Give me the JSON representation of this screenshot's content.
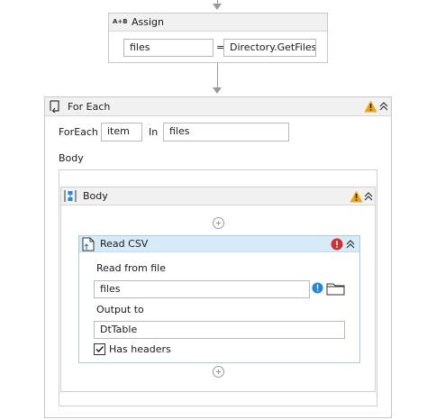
{
  "assign": {
    "icon_text": "A+B",
    "title": "Assign",
    "left_value": "files",
    "operator": "=",
    "right_value": "Directory.GetFiles("
  },
  "foreach": {
    "title": "For Each",
    "foreach_label": "ForEach",
    "item_value": "item",
    "in_label": "In",
    "collection_value": "files",
    "body_label": "Body"
  },
  "body_sequence": {
    "title": "Body"
  },
  "read_csv": {
    "title": "Read CSV",
    "read_from_label": "Read from file",
    "read_from_value": "files",
    "output_label": "Output to",
    "output_value": "DtTable",
    "has_headers_label": "Has headers",
    "has_headers_checked": true
  },
  "colors": {
    "warning": "#f0a30a",
    "error": "#d32f2f",
    "info": "#1e88e5",
    "selection_header": "#d7eaf8",
    "selection_border": "#a8cbe8"
  }
}
